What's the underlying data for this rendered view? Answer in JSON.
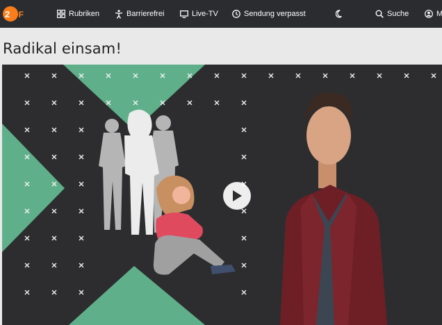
{
  "header": {
    "logo": "ZDF",
    "nav": [
      {
        "label": "Rubriken",
        "icon": "grid-icon"
      },
      {
        "label": "Barrierefrei",
        "icon": "accessibility-icon"
      },
      {
        "label": "Live-TV",
        "icon": "tv-icon"
      },
      {
        "label": "Sendung verpasst",
        "icon": "clock-icon"
      },
      {
        "label": "",
        "icon": "moon-icon"
      },
      {
        "label": "Suche",
        "icon": "search-icon"
      },
      {
        "label": "M",
        "icon": "user-icon"
      }
    ]
  },
  "page": {
    "title": "Radikal einsam!"
  },
  "hero": {
    "play_icon": "play-icon",
    "accent_color": "#5fb08a",
    "background_color": "#2d2d2f"
  }
}
